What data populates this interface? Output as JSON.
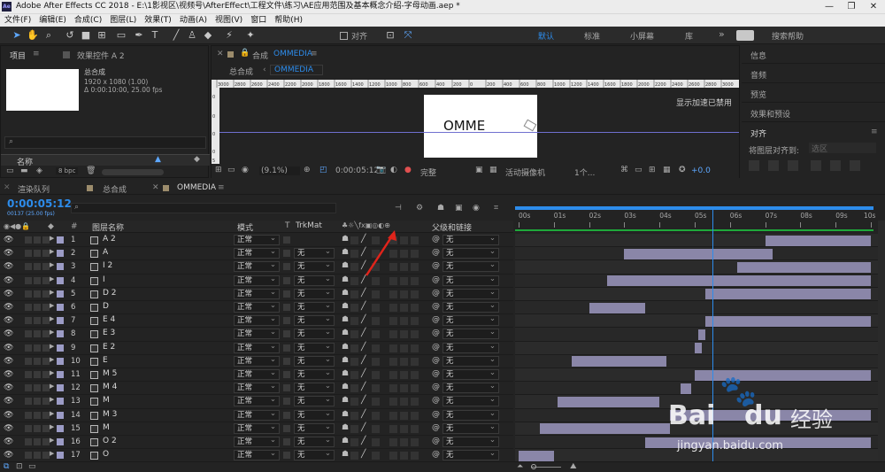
{
  "app": {
    "title": "Adobe After Effects CC 2018 - E:\\1影视区\\视频号\\AfterEffect\\工程文件\\练习\\AE应用范围及基本概念介绍-字母动画.aep *",
    "icon": "Ae"
  },
  "window_controls": [
    "—",
    "❐",
    "✕"
  ],
  "menu": [
    "文件(F)",
    "编辑(E)",
    "合成(C)",
    "图层(L)",
    "效果(T)",
    "动画(A)",
    "视图(V)",
    "窗口",
    "帮助(H)"
  ],
  "toolbar": {
    "align_label": "对齐",
    "workspaces": [
      "默认",
      "标准",
      "小屏幕",
      "库"
    ],
    "more": "»",
    "search_placeholder": "搜索帮助"
  },
  "project_panel": {
    "tab_project": "项目",
    "tab_effects": "效果控件 A 2",
    "comp_name": "总合成",
    "comp_size": "1920 x 1080 (1.00)",
    "comp_duration": "Δ 0:00:10:00, 25.00 fps",
    "search_placeholder": "",
    "col_name": "名称",
    "bpc": "8 bpc"
  },
  "comp_panel": {
    "tab_label": "合成",
    "tab_name": "OMMEDIA",
    "crumbs": [
      "总合成",
      "OMMEDIA"
    ],
    "ruler_labels": [
      "3000",
      "2800",
      "2600",
      "2400",
      "2200",
      "2000",
      "1800",
      "1600",
      "1400",
      "1200",
      "1000",
      "800",
      "600",
      "400",
      "200",
      "0",
      "200",
      "400",
      "600",
      "800",
      "1000",
      "1200",
      "1400",
      "1600",
      "1800",
      "2000",
      "2200",
      "2400",
      "2600",
      "2800",
      "3000"
    ],
    "vruler_labels": [
      "0",
      "0",
      "0",
      "0",
      "5"
    ],
    "canvas_text": "OMME",
    "gpu_notice": "显示加速已禁用",
    "zoom": "(9.1%)",
    "timecode": "0:00:05:12",
    "quality": "完整",
    "camera": "活动摄像机",
    "views": "1个...",
    "exposure": "+0.0"
  },
  "right_panel": {
    "items": [
      "信息",
      "音频",
      "预览",
      "效果和预设"
    ],
    "align": {
      "title": "对齐",
      "label": "将图层对齐到:",
      "option": "选区"
    }
  },
  "timeline": {
    "tabs": [
      "渲染队列",
      "总合成",
      "OMMEDIA"
    ],
    "timecode": "0:00:05:12",
    "frame_info": "00137 (25.00 fps)",
    "search_placeholder": "",
    "headers": {
      "num": "#",
      "name": "图层名称",
      "mode": "模式",
      "t": "T",
      "trkmat": "TrkMat",
      "parent": "父级和链接"
    },
    "ruler": [
      "00s",
      "01s",
      "02s",
      "03s",
      "04s",
      "05s",
      "06s",
      "07s",
      "08s",
      "09s",
      "10s"
    ],
    "layers": [
      {
        "num": "1",
        "name": "A 2",
        "mode": "正常",
        "trk": "",
        "parent": "无",
        "start": 7.0,
        "end": 10.0
      },
      {
        "num": "2",
        "name": "A",
        "mode": "正常",
        "trk": "无",
        "parent": "无",
        "start": 3.0,
        "end": 7.2
      },
      {
        "num": "3",
        "name": "I 2",
        "mode": "正常",
        "trk": "无",
        "parent": "无",
        "start": 6.2,
        "end": 10.0
      },
      {
        "num": "4",
        "name": "I",
        "mode": "正常",
        "trk": "无",
        "parent": "无",
        "start": 2.5,
        "end": 10.0
      },
      {
        "num": "5",
        "name": "D 2",
        "mode": "正常",
        "trk": "无",
        "parent": "无",
        "start": 5.3,
        "end": 10.0
      },
      {
        "num": "6",
        "name": "D",
        "mode": "正常",
        "trk": "无",
        "parent": "无",
        "start": 2.0,
        "end": 3.6
      },
      {
        "num": "7",
        "name": "E 4",
        "mode": "正常",
        "trk": "无",
        "parent": "无",
        "start": 5.3,
        "end": 10.0
      },
      {
        "num": "8",
        "name": "E 3",
        "mode": "正常",
        "trk": "无",
        "parent": "无",
        "start": 5.1,
        "end": 5.3
      },
      {
        "num": "9",
        "name": "E 2",
        "mode": "正常",
        "trk": "无",
        "parent": "无",
        "start": 5.0,
        "end": 5.2
      },
      {
        "num": "10",
        "name": "E",
        "mode": "正常",
        "trk": "无",
        "parent": "无",
        "start": 1.5,
        "end": 4.2
      },
      {
        "num": "11",
        "name": "M 5",
        "mode": "正常",
        "trk": "无",
        "parent": "无",
        "start": 5.0,
        "end": 10.0
      },
      {
        "num": "12",
        "name": "M 4",
        "mode": "正常",
        "trk": "无",
        "parent": "无",
        "start": 4.6,
        "end": 4.9
      },
      {
        "num": "13",
        "name": "M",
        "mode": "正常",
        "trk": "无",
        "parent": "无",
        "start": 1.1,
        "end": 4.0
      },
      {
        "num": "14",
        "name": "M 3",
        "mode": "正常",
        "trk": "无",
        "parent": "无",
        "start": 4.3,
        "end": 10.0
      },
      {
        "num": "15",
        "name": "M",
        "mode": "正常",
        "trk": "无",
        "parent": "无",
        "start": 0.6,
        "end": 4.3
      },
      {
        "num": "16",
        "name": "O 2",
        "mode": "正常",
        "trk": "无",
        "parent": "无",
        "start": 3.6,
        "end": 10.0
      },
      {
        "num": "17",
        "name": "O",
        "mode": "正常",
        "trk": "无",
        "parent": "无",
        "start": 0.0,
        "end": 1.0
      }
    ],
    "playhead_sec": 5.5
  },
  "watermark": {
    "brand": "Bai",
    "brand2": "du",
    "sub": "经验",
    "url": "jingyan.baidu.com"
  },
  "colors": {
    "accent": "#2d8ceb",
    "bar": "#8a86a8",
    "label": "#9c9cc6",
    "arrow": "#e0241b"
  }
}
